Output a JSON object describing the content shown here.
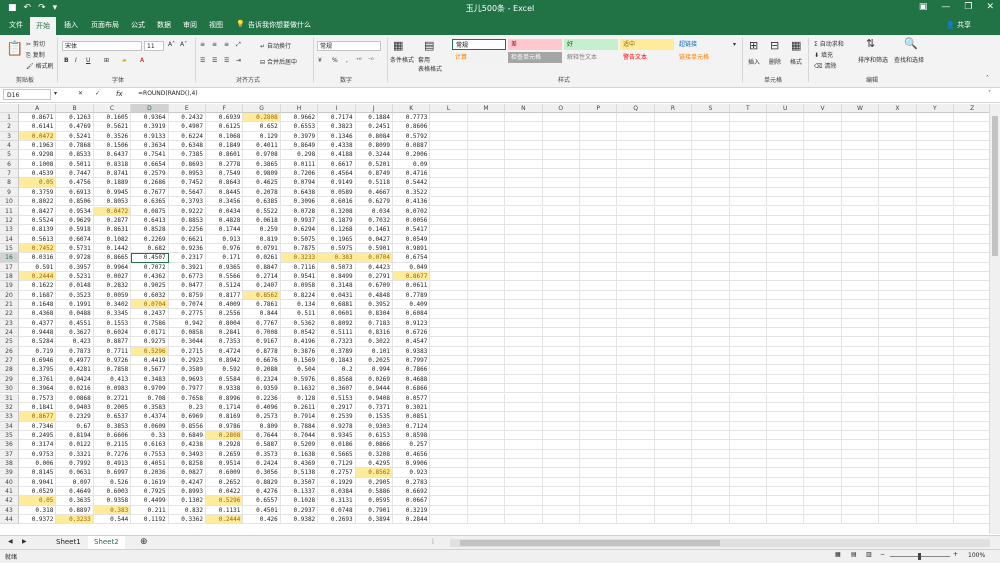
{
  "window": {
    "title": "玉儿500条 - Excel",
    "user": "共享"
  },
  "tabs": [
    "文件",
    "开始",
    "插入",
    "页面布局",
    "公式",
    "数据",
    "审阅",
    "视图"
  ],
  "tell_me": "告诉我你想要做什么",
  "clipboard": {
    "cut": "剪切",
    "copy": "复制",
    "painter": "格式刷",
    "label": "剪贴板"
  },
  "font": {
    "name": "宋体",
    "size": "11",
    "label": "字体",
    "bold": "B",
    "italic": "I",
    "underline": "U"
  },
  "alignment": {
    "wrap": "自动换行",
    "merge": "合并后居中",
    "label": "对齐方式"
  },
  "number": {
    "format": "常规",
    "label": "数字",
    "pct": "%",
    "comma": ","
  },
  "styles": {
    "cond": "条件格式",
    "table": "套用\n表格格式",
    "label": "样式",
    "items": [
      {
        "text": "常规",
        "bg": "#ffffff",
        "fg": "#000000"
      },
      {
        "text": "差",
        "bg": "#ffc7ce",
        "fg": "#9c0006"
      },
      {
        "text": "好",
        "bg": "#c6efce",
        "fg": "#006100"
      },
      {
        "text": "适中",
        "bg": "#ffeb9c",
        "fg": "#9c6500"
      },
      {
        "text": "超链接",
        "bg": "#f3f3f3",
        "fg": "#0563c1"
      },
      {
        "text": "计算",
        "bg": "#f2f2f2",
        "fg": "#fa7d00"
      },
      {
        "text": "检查单元格",
        "bg": "#a5a5a5",
        "fg": "#ffffff"
      },
      {
        "text": "解释性文本",
        "bg": "#f3f3f3",
        "fg": "#7f7f7f"
      },
      {
        "text": "警告文本",
        "bg": "#f3f3f3",
        "fg": "#ff0000"
      },
      {
        "text": "链接单元格",
        "bg": "#f3f3f3",
        "fg": "#fa7d00"
      }
    ]
  },
  "cells": {
    "insert": "插入",
    "delete": "删除",
    "format": "格式",
    "label": "单元格"
  },
  "editing": {
    "autosum": "自动求和",
    "fill": "填充",
    "clear": "清除",
    "sort": "排序和筛选",
    "find": "查找和选择",
    "label": "编辑"
  },
  "formula_bar": {
    "name_box": "D16",
    "fx": "fx",
    "formula": "=ROUND(RAND(),4)"
  },
  "columns": [
    "A",
    "B",
    "C",
    "D",
    "E",
    "F",
    "G",
    "H",
    "I",
    "J",
    "K",
    "L",
    "M",
    "N",
    "O",
    "P",
    "Q",
    "R",
    "S",
    "T",
    "U",
    "V",
    "W",
    "X",
    "Y",
    "Z"
  ],
  "rows": [
    [
      "0.8671",
      "0.1263",
      "0.1605",
      "0.9364",
      "0.2432",
      "0.6939",
      "0.2808",
      "0.9662",
      "0.7174",
      "0.1884",
      "0.7773"
    ],
    [
      "0.6141",
      "0.4769",
      "0.5621",
      "0.3919",
      "0.4907",
      "0.6125",
      "0.652",
      "0.6553",
      "0.3823",
      "0.2451",
      "0.8606"
    ],
    [
      "0.0472",
      "0.5241",
      "0.3526",
      "0.9133",
      "0.6224",
      "0.1068",
      "0.129",
      "0.3979",
      "0.1346",
      "0.8084",
      "0.5792"
    ],
    [
      "0.1963",
      "0.7868",
      "0.1506",
      "0.3634",
      "0.6348",
      "0.1849",
      "0.4011",
      "0.8649",
      "0.4338",
      "0.8099",
      "0.0887"
    ],
    [
      "0.9298",
      "0.8533",
      "0.6437",
      "0.7541",
      "0.7385",
      "0.8601",
      "0.9708",
      "0.298",
      "0.4188",
      "0.3244",
      "0.2006"
    ],
    [
      "0.1008",
      "0.5011",
      "0.8318",
      "0.6654",
      "0.8693",
      "0.2778",
      "0.3865",
      "0.0111",
      "0.6617",
      "0.5201",
      "0.09"
    ],
    [
      "0.4539",
      "0.7447",
      "0.8741",
      "0.2579",
      "0.0953",
      "0.7549",
      "0.9809",
      "0.7206",
      "0.4564",
      "0.8749",
      "0.4716"
    ],
    [
      "0.05",
      "0.4756",
      "0.1889",
      "0.2686",
      "0.7452",
      "0.8643",
      "0.4625",
      "0.0794",
      "0.9149",
      "0.5118",
      "0.5442"
    ],
    [
      "0.3759",
      "0.6913",
      "0.9945",
      "0.7677",
      "0.5647",
      "0.8445",
      "0.2078",
      "0.6438",
      "0.0589",
      "0.4667",
      "0.3522"
    ],
    [
      "0.8022",
      "0.8506",
      "0.8053",
      "0.6365",
      "0.3793",
      "0.3456",
      "0.6385",
      "0.3096",
      "0.6016",
      "0.6279",
      "0.4136"
    ],
    [
      "0.8427",
      "0.9534",
      "0.0472",
      "0.0875",
      "0.9222",
      "0.0434",
      "0.5522",
      "0.0728",
      "0.3208",
      "0.034",
      "0.0702"
    ],
    [
      "0.5524",
      "0.9629",
      "0.2877",
      "0.6413",
      "0.8853",
      "0.4828",
      "0.0618",
      "0.9937",
      "0.1879",
      "0.7032",
      "0.0056"
    ],
    [
      "0.8139",
      "0.5918",
      "0.8631",
      "0.8528",
      "0.2256",
      "0.1744",
      "0.259",
      "0.6294",
      "0.1268",
      "0.1461",
      "0.5417"
    ],
    [
      "0.5613",
      "0.6074",
      "0.1082",
      "0.2269",
      "0.6621",
      "0.913",
      "0.819",
      "0.5075",
      "0.1965",
      "0.0427",
      "0.0549"
    ],
    [
      "0.7452",
      "0.5731",
      "0.1442",
      "0.682",
      "0.9236",
      "0.976",
      "0.0791",
      "0.7875",
      "0.5975",
      "0.5901",
      "0.9891"
    ],
    [
      "0.0316",
      "0.9728",
      "0.8665",
      "0.4507",
      "0.2317",
      "0.171",
      "0.0261",
      "0.3233",
      "0.383",
      "0.0704",
      "0.6754"
    ],
    [
      "0.591",
      "0.3957",
      "0.9964",
      "0.7072",
      "0.3921",
      "0.9365",
      "0.8847",
      "0.7116",
      "0.5073",
      "0.4423",
      "0.049"
    ],
    [
      "0.2444",
      "0.5231",
      "0.0027",
      "0.4362",
      "0.6773",
      "0.5566",
      "0.2714",
      "0.9541",
      "0.8499",
      "0.2791",
      "0.8677"
    ],
    [
      "0.1622",
      "0.0148",
      "0.2832",
      "0.9025",
      "0.0477",
      "0.5124",
      "0.2407",
      "0.0958",
      "0.3148",
      "0.6709",
      "0.0611"
    ],
    [
      "0.1687",
      "0.3523",
      "0.0059",
      "0.6032",
      "0.8759",
      "0.8177",
      "0.8562",
      "0.8224",
      "0.0431",
      "0.4848",
      "0.7789"
    ],
    [
      "0.1648",
      "0.1991",
      "0.3402",
      "0.0704",
      "0.7074",
      "0.4009",
      "0.7861",
      "0.134",
      "0.6881",
      "0.3952",
      "0.409"
    ],
    [
      "0.4368",
      "0.0488",
      "0.3345",
      "0.2437",
      "0.2775",
      "0.2556",
      "0.844",
      "0.511",
      "0.0601",
      "0.8304",
      "0.6084"
    ],
    [
      "0.4377",
      "0.4551",
      "0.1553",
      "0.7586",
      "0.942",
      "0.8004",
      "0.7767",
      "0.5362",
      "0.8092",
      "0.7183",
      "0.9123"
    ],
    [
      "0.9448",
      "0.3627",
      "0.6024",
      "0.0171",
      "0.0858",
      "0.2841",
      "0.7008",
      "0.0542",
      "0.5111",
      "0.8316",
      "0.6726"
    ],
    [
      "0.5284",
      "0.423",
      "0.8877",
      "0.9275",
      "0.3044",
      "0.7353",
      "0.9167",
      "0.4196",
      "0.7323",
      "0.3022",
      "0.4547"
    ],
    [
      "0.719",
      "0.7873",
      "0.7711",
      "0.5296",
      "0.2715",
      "0.4724",
      "0.8778",
      "0.3876",
      "0.3789",
      "0.101",
      "0.9383"
    ],
    [
      "0.6946",
      "0.4977",
      "0.9726",
      "0.4419",
      "0.2923",
      "0.8942",
      "0.6676",
      "0.1569",
      "0.1843",
      "0.2025",
      "0.7997"
    ],
    [
      "0.3795",
      "0.4281",
      "0.7858",
      "0.5677",
      "0.3589",
      "0.592",
      "0.2088",
      "0.504",
      "0.2",
      "0.994",
      "0.7866"
    ],
    [
      "0.3761",
      "0.0424",
      "0.413",
      "0.3483",
      "0.9693",
      "0.5584",
      "0.2324",
      "0.5976",
      "0.8568",
      "0.0269",
      "0.4688"
    ],
    [
      "0.3964",
      "0.0216",
      "0.0983",
      "0.9709",
      "0.7977",
      "0.9338",
      "0.9359",
      "0.1632",
      "0.3607",
      "0.9444",
      "0.6866"
    ],
    [
      "0.7573",
      "0.0868",
      "0.2721",
      "0.708",
      "0.7658",
      "0.8996",
      "0.2236",
      "0.128",
      "0.5153",
      "0.9408",
      "0.0577"
    ],
    [
      "0.1841",
      "0.9403",
      "0.2005",
      "0.3583",
      "0.23",
      "0.1714",
      "0.4096",
      "0.2611",
      "0.2917",
      "0.7371",
      "0.3021"
    ],
    [
      "0.8677",
      "0.2329",
      "0.6537",
      "0.4374",
      "0.6969",
      "0.8169",
      "0.2573",
      "0.7914",
      "0.2539",
      "0.1535",
      "0.0851"
    ],
    [
      "0.7346",
      "0.67",
      "0.3853",
      "0.0609",
      "0.8556",
      "0.9786",
      "0.809",
      "0.7884",
      "0.9278",
      "0.9303",
      "0.7124"
    ],
    [
      "0.2495",
      "0.8194",
      "0.6606",
      "0.33",
      "0.6849",
      "0.2808",
      "0.7644",
      "0.7044",
      "0.9345",
      "0.6153",
      "0.8598"
    ],
    [
      "0.3174",
      "0.0122",
      "0.2115",
      "0.6163",
      "0.4238",
      "0.2928",
      "0.5887",
      "0.5209",
      "0.0186",
      "0.0866",
      "0.257"
    ],
    [
      "0.9753",
      "0.3321",
      "0.7276",
      "0.7553",
      "0.3493",
      "0.2659",
      "0.3573",
      "0.1638",
      "0.5665",
      "0.3208",
      "0.4656"
    ],
    [
      "0.006",
      "0.7992",
      "0.4913",
      "0.4051",
      "0.8258",
      "0.9514",
      "0.2424",
      "0.4369",
      "0.7129",
      "0.4295",
      "0.9906"
    ],
    [
      "0.8145",
      "0.0631",
      "0.6997",
      "0.2036",
      "0.0827",
      "0.6009",
      "0.3056",
      "0.5138",
      "0.2757",
      "0.8562",
      "0.923"
    ],
    [
      "0.9041",
      "0.097",
      "0.526",
      "0.1619",
      "0.4247",
      "0.2652",
      "0.8829",
      "0.3507",
      "0.1929",
      "0.2905",
      "0.2783"
    ],
    [
      "0.0529",
      "0.4649",
      "0.6003",
      "0.7925",
      "0.8993",
      "0.0422",
      "0.4276",
      "0.1337",
      "0.0384",
      "0.5886",
      "0.6692"
    ],
    [
      "0.05",
      "0.3635",
      "0.9358",
      "0.4499",
      "0.1302",
      "0.5296",
      "0.6557",
      "0.1028",
      "0.3131",
      "0.0595",
      "0.0667"
    ],
    [
      "0.318",
      "0.8897",
      "0.383",
      "0.211",
      "0.832",
      "0.1131",
      "0.4501",
      "0.2937",
      "0.0748",
      "0.7901",
      "0.3219"
    ],
    [
      "0.9372",
      "0.3233",
      "0.544",
      "0.1192",
      "0.3362",
      "0.2444",
      "0.426",
      "0.9382",
      "0.2693",
      "0.3894",
      "0.2844"
    ]
  ],
  "highlighted": [
    [
      1,
      7
    ],
    [
      3,
      1
    ],
    [
      8,
      1
    ],
    [
      11,
      3
    ],
    [
      15,
      1
    ],
    [
      16,
      8
    ],
    [
      16,
      9
    ],
    [
      16,
      10
    ],
    [
      18,
      1
    ],
    [
      18,
      11
    ],
    [
      20,
      7
    ],
    [
      21,
      4
    ],
    [
      26,
      4
    ],
    [
      33,
      1
    ],
    [
      35,
      6
    ],
    [
      39,
      10
    ],
    [
      42,
      1
    ],
    [
      42,
      6
    ],
    [
      43,
      3
    ],
    [
      44,
      2
    ],
    [
      44,
      6
    ]
  ],
  "selected_cell": [
    16,
    4
  ],
  "sheets": [
    "Sheet1",
    "Sheet2"
  ],
  "active_sheet": 1,
  "status": {
    "ready": "就绪",
    "zoom": "100%"
  }
}
